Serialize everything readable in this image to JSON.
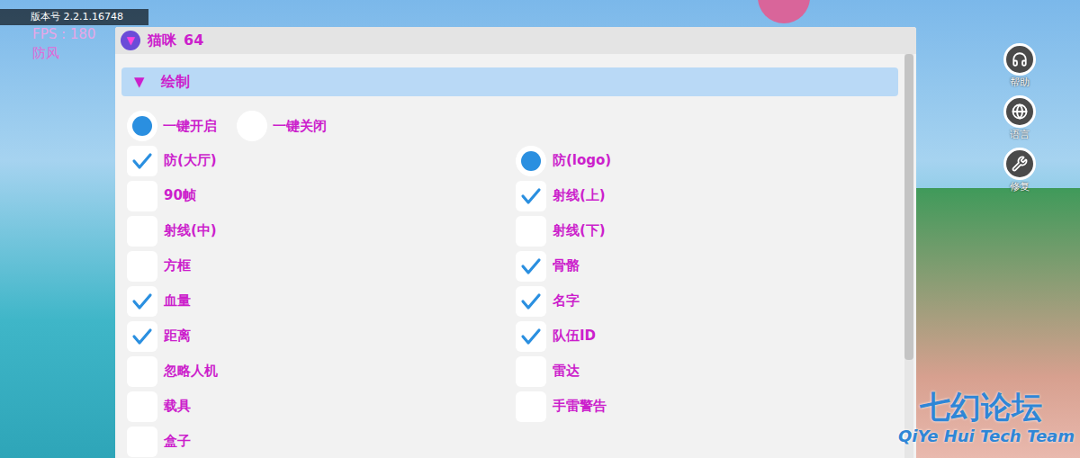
{
  "status": {
    "version": "版本号 2.2.1.16748",
    "fps": "FPS : 180",
    "mode": "防风"
  },
  "panel": {
    "icon": "▼",
    "title": "猫咪",
    "count": "64"
  },
  "section": {
    "arrow": "▼",
    "title": "绘制",
    "expanded": true
  },
  "radios": [
    {
      "label": "一键开启",
      "selected": true
    },
    {
      "label": "一键关闭",
      "selected": false
    }
  ],
  "options": [
    {
      "label": "防(大厅)",
      "kind": "checkbox",
      "checked": true
    },
    {
      "label": "防(logo)",
      "kind": "radio",
      "checked": true
    },
    {
      "label": "90帧",
      "kind": "checkbox",
      "checked": false
    },
    {
      "label": "射线(上)",
      "kind": "checkbox",
      "checked": true
    },
    {
      "label": "射线(中)",
      "kind": "checkbox",
      "checked": false
    },
    {
      "label": "射线(下)",
      "kind": "checkbox",
      "checked": false
    },
    {
      "label": "方框",
      "kind": "checkbox",
      "checked": false
    },
    {
      "label": "骨骼",
      "kind": "checkbox",
      "checked": true
    },
    {
      "label": "血量",
      "kind": "checkbox",
      "checked": true
    },
    {
      "label": "名字",
      "kind": "checkbox",
      "checked": true
    },
    {
      "label": "距离",
      "kind": "checkbox",
      "checked": true
    },
    {
      "label": "队伍ID",
      "kind": "checkbox",
      "checked": true
    },
    {
      "label": "忽略人机",
      "kind": "checkbox",
      "checked": false
    },
    {
      "label": "雷达",
      "kind": "checkbox",
      "checked": false
    },
    {
      "label": "载具",
      "kind": "checkbox",
      "checked": false
    },
    {
      "label": "手雷警告",
      "kind": "checkbox",
      "checked": false
    },
    {
      "label": "盒子",
      "kind": "checkbox",
      "checked": false
    }
  ],
  "side_buttons": [
    "帮助",
    "语言",
    "修复"
  ],
  "watermark": {
    "title": "七幻论坛",
    "subtitle": "QiYe Hui Tech Team"
  }
}
